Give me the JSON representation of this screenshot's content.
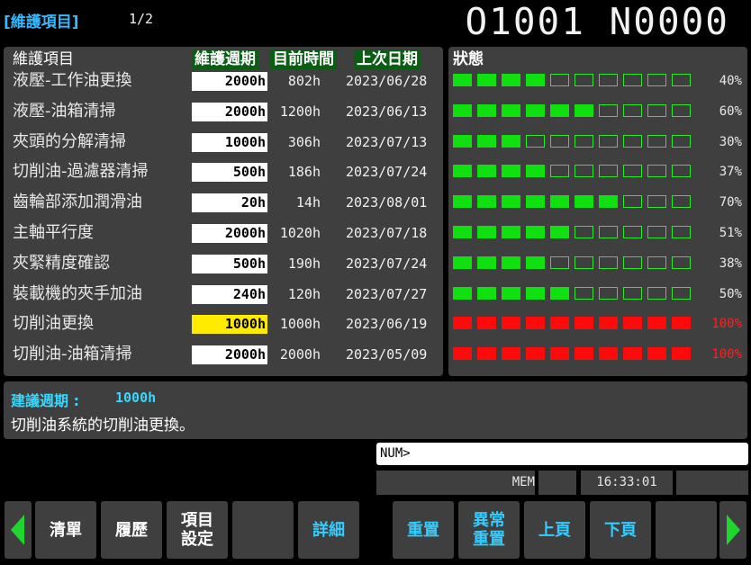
{
  "header": {
    "title": "[維護項目]",
    "page": "1/2",
    "program": "O1001 N0000"
  },
  "columns": {
    "item": "維護項目",
    "cycle": "維護週期",
    "current": "目前時間",
    "last": "上次日期",
    "status": "狀態"
  },
  "rows": [
    {
      "name": "液壓-工作油更換",
      "cycle": "2000h",
      "current": "802h",
      "last": "2023/06/28",
      "percent": 40,
      "percent_label": "40%",
      "segments_on": 4,
      "color": "green",
      "highlight": false
    },
    {
      "name": "液壓-油箱清掃",
      "cycle": "2000h",
      "current": "1200h",
      "last": "2023/06/13",
      "percent": 60,
      "percent_label": "60%",
      "segments_on": 6,
      "color": "green",
      "highlight": false
    },
    {
      "name": "夾頭的分解清掃",
      "cycle": "1000h",
      "current": "306h",
      "last": "2023/07/13",
      "percent": 30,
      "percent_label": "30%",
      "segments_on": 3,
      "color": "green",
      "highlight": false
    },
    {
      "name": "切削油-過濾器清掃",
      "cycle": "500h",
      "current": "186h",
      "last": "2023/07/24",
      "percent": 37,
      "percent_label": "37%",
      "segments_on": 4,
      "color": "green",
      "highlight": false
    },
    {
      "name": "齒輪部添加潤滑油",
      "cycle": "20h",
      "current": "14h",
      "last": "2023/08/01",
      "percent": 70,
      "percent_label": "70%",
      "segments_on": 7,
      "color": "green",
      "highlight": false
    },
    {
      "name": "主軸平行度",
      "cycle": "2000h",
      "current": "1020h",
      "last": "2023/07/18",
      "percent": 51,
      "percent_label": "51%",
      "segments_on": 5,
      "color": "green",
      "highlight": false
    },
    {
      "name": "夾緊精度確認",
      "cycle": "500h",
      "current": "190h",
      "last": "2023/07/24",
      "percent": 38,
      "percent_label": "38%",
      "segments_on": 4,
      "color": "green",
      "highlight": false
    },
    {
      "name": "裝載機的夾手加油",
      "cycle": "240h",
      "current": "120h",
      "last": "2023/07/27",
      "percent": 50,
      "percent_label": "50%",
      "segments_on": 5,
      "color": "green",
      "highlight": false
    },
    {
      "name": "切削油更換",
      "cycle": "1000h",
      "current": "1000h",
      "last": "2023/06/19",
      "percent": 100,
      "percent_label": "100%",
      "segments_on": 10,
      "color": "red",
      "highlight": true
    },
    {
      "name": "切削油-油箱清掃",
      "cycle": "2000h",
      "current": "2000h",
      "last": "2023/05/09",
      "percent": 100,
      "percent_label": "100%",
      "segments_on": 10,
      "color": "red",
      "highlight": false
    }
  ],
  "info": {
    "suggest_label": "建議週期 :",
    "suggest_value": "1000h",
    "description": "切削油系統的切削油更換。"
  },
  "input": {
    "prompt": "NUM>"
  },
  "status_bar": {
    "mode": "MEM",
    "time": "16:33:01"
  },
  "softkeys": {
    "list": "清單",
    "history": "履歷",
    "item_settings": "項目\n設定",
    "blank1": "",
    "detail": "詳細",
    "reset": "重置",
    "alarm_reset": "異常\n重置",
    "page_up": "上頁",
    "page_down": "下頁",
    "blank2": ""
  },
  "colors": {
    "accent_blue": "#35b8ff",
    "bar_green": "#10e010",
    "bar_red": "#ff0a0a",
    "highlight_yellow": "#ffeb00",
    "header_green": "#0b5d14",
    "panel_gray": "#3f3f3f"
  }
}
